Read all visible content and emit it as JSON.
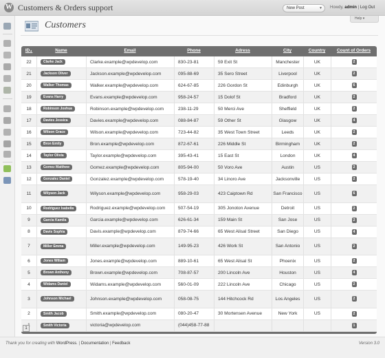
{
  "header": {
    "site_title": "Customers & Orders support",
    "new_post_label": "New Post",
    "howdy": "Howdy,",
    "username": "admin",
    "separator": "|",
    "logout": "Log Out",
    "logo": "W"
  },
  "menu_icons": [
    "dashboard-icon",
    "posts-icon",
    "media-icon",
    "links-icon",
    "pages-icon",
    "comments-icon",
    "appearance-icon",
    "plugins-icon",
    "users-icon",
    "tools-icon",
    "settings-icon",
    "customers-plugin-icon",
    "orders-plugin-icon"
  ],
  "page": {
    "title": "Customers",
    "help": "Help"
  },
  "table": {
    "columns": {
      "id": "ID",
      "sort_arrow": "▲",
      "name": "Name",
      "email": "Email",
      "phone": "Phone",
      "address": "Adress",
      "city": "City",
      "country": "Country",
      "orders": "Count of Orders"
    },
    "rows": [
      {
        "id": "22",
        "name": "Clarke Jack",
        "email": "Clarke.example@wpdevelop.com",
        "phone": "830-23-81",
        "address": "59 Exit St",
        "city": "Manchester",
        "country": "UK",
        "orders": "2"
      },
      {
        "id": "21",
        "name": "Jackson Oliver",
        "email": "Jackson.example@wpdevelop.com",
        "phone": "095-88-69",
        "address": "35 Sero Street",
        "city": "Liverpool",
        "country": "UK",
        "orders": "2"
      },
      {
        "id": "20",
        "name": "Walker Thomas",
        "email": "Walker.example@wpdevelop.com",
        "phone": "624-67-85",
        "address": "226 Gordon St",
        "city": "Edinburgh",
        "country": "UK",
        "orders": "6"
      },
      {
        "id": "19",
        "name": "Evans Harry",
        "email": "Evans.example@wpdevelop.com",
        "phone": "958-24-57",
        "address": "15 Dolof St",
        "city": "Bradford",
        "country": "UK",
        "orders": "2"
      },
      {
        "id": "18",
        "name": "Robinson Joshua",
        "email": "Robinson.example@wpdevelop.com",
        "phone": "238-11-29",
        "address": "50 Merci Ave",
        "city": "Sheffield",
        "country": "UK",
        "orders": "2"
      },
      {
        "id": "17",
        "name": "Davies Jessica",
        "email": "Davies.example@wpdevelop.com",
        "phone": "088-84-87",
        "address": "59 Other St",
        "city": "Glasgow",
        "country": "UK",
        "orders": "4"
      },
      {
        "id": "16",
        "name": "Wilson Grace",
        "email": "Wilson.example@wpdevelop.com",
        "phone": "723-44-82",
        "address": "35 West Town Street",
        "city": "Leeds",
        "country": "UK",
        "orders": "2"
      },
      {
        "id": "15",
        "name": "Bron Emily",
        "email": "Bron.example@wpdevelop.com",
        "phone": "872-67-61",
        "address": "226 Middle St",
        "city": "Birmingham",
        "country": "UK",
        "orders": "2"
      },
      {
        "id": "14",
        "name": "Taylor Olivia",
        "email": "Taylor.example@wpdevelop.com",
        "phone": "395-43-41",
        "address": "15 East St",
        "city": "London",
        "country": "UK",
        "orders": "4"
      },
      {
        "id": "13",
        "name": "Gomez Matthew",
        "email": "Gomez.example@wpdevelop.com",
        "phone": "805-94-00",
        "address": "50 Voro Ave",
        "city": "Austin",
        "country": "US",
        "orders": "2"
      },
      {
        "id": "12",
        "name": "Gonzalez Daniel",
        "email": "Gonzalez.example@wpdevelop.com",
        "phone": "578-19-40",
        "address": "34 Linoro Ave",
        "city": "Jacksonville",
        "country": "US",
        "orders": "2"
      },
      {
        "id": "11",
        "name": "Wilyson Jack",
        "email": "Wilyson.example@wpdevelop.com",
        "phone": "958-29-03",
        "address": "423 Caiptown Rd",
        "city": "San Francisco",
        "country": "US",
        "orders": "6"
      },
      {
        "id": "10",
        "name": "Rodriguez Isabella",
        "email": "Rodriguez.example@wpdevelop.com",
        "phone": "507-54-19",
        "address": "305 Jonoton Avenue",
        "city": "Detroit",
        "country": "US",
        "orders": "2"
      },
      {
        "id": "9",
        "name": "Garcia Kamila",
        "email": "Garcia.example@wpdevelop.com",
        "phone": "626-61-34",
        "address": "159 Main St",
        "city": "San Jose",
        "country": "US",
        "orders": "2"
      },
      {
        "id": "8",
        "name": "Davis Sophia",
        "email": "Davis.example@wpdevelop.com",
        "phone": "879-74-66",
        "address": "65 West Alisal Street",
        "city": "San Diego",
        "country": "US",
        "orders": "4"
      },
      {
        "id": "7",
        "name": "Miller Emma",
        "email": "Miller.example@wpdevelop.com",
        "phone": "149-95-23",
        "address": "426 Work St",
        "city": "San Antonio",
        "country": "US",
        "orders": "2"
      },
      {
        "id": "6",
        "name": "Jones Wiliam",
        "email": "Jones.example@wpdevelop.com",
        "phone": "889-10-61",
        "address": "65 West Alisal St",
        "city": "Phoenix",
        "country": "US",
        "orders": "2"
      },
      {
        "id": "5",
        "name": "Brown Anthony",
        "email": "Brown.example@wpdevelop.com",
        "phone": "708-87-57",
        "address": "200 Lincoln Ave",
        "city": "Houston",
        "country": "US",
        "orders": "4"
      },
      {
        "id": "4",
        "name": "Widams Daniel",
        "email": "Widams.example@wpdevelop.com",
        "phone": "560-01-09",
        "address": "222 Lincoln Ave",
        "city": "Chicago",
        "country": "US",
        "orders": "2"
      },
      {
        "id": "3",
        "name": "Johnson Michael",
        "email": "Johnson.example@wpdevelop.com",
        "phone": "058-08-75",
        "address": "144 Hitchcock Rd",
        "city": "Los Angeles",
        "country": "US",
        "orders": "2"
      },
      {
        "id": "2",
        "name": "Smith Jacob",
        "email": "Smith.example@wpdevelop.com",
        "phone": "080-20-47",
        "address": "30 Mortensen Avenue",
        "city": "New York",
        "country": "US",
        "orders": "2"
      },
      {
        "id": "1",
        "name": "Smith Victoria",
        "email": "victoria@wpdevelop.com",
        "phone": "(044)458-77-88",
        "address": "",
        "city": "",
        "country": "",
        "orders": "1"
      }
    ],
    "page_number": "1"
  },
  "footer": {
    "thanks": "Thank you for creating with",
    "wordpress": "WordPress",
    "sep1": ".",
    "documentation": "Documentation",
    "feedback": "Feedback",
    "version": "Version 3.0"
  },
  "colors": {
    "panel": "#6f6f6f",
    "badge": "#6a6a6a",
    "header": "#dcdcdc"
  }
}
